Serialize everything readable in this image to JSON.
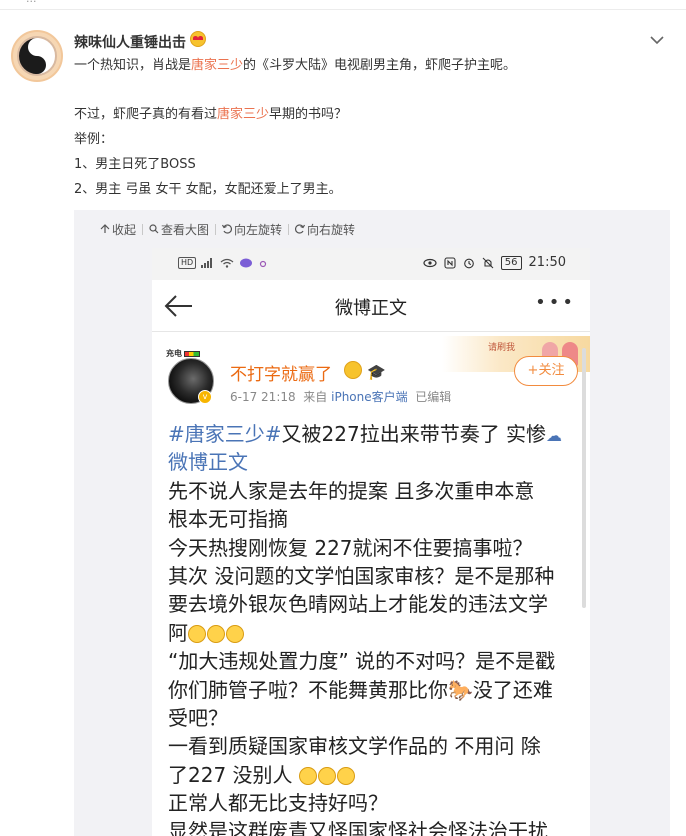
{
  "top_strip": {
    "label": " ..."
  },
  "post": {
    "author": "辣味仙人重锤出击",
    "line1_a": "一个热知识，肖战是",
    "line1_hl": "唐家三少",
    "line1_b": "的《斗罗大陆》电视剧男主角，虾爬子护主呢。",
    "line2_a": "不过，虾爬子真的有看过",
    "line2_hl": "唐家三少",
    "line2_b": "早期的书吗？",
    "line3": "举例：",
    "line4": "1、男主日死了BOSS",
    "line5": "2、男主 弓虽 女干 女配，女配还爱上了男主。"
  },
  "toolbar": {
    "collapse": "收起",
    "view_large": "查看大图",
    "rotate_left": "向左旋转",
    "rotate_right": "向右旋转"
  },
  "phone": {
    "status": {
      "hd": "HD",
      "battery": "56",
      "time": "21:50"
    },
    "nav_title": "微博正文",
    "banner_text": "请刷我",
    "charge_label": "充电",
    "author_name": "不打字就赢了",
    "meta_time": "6-17 21:18",
    "meta_from": "来自",
    "meta_source": "iPhone客户端",
    "meta_edited": "已编辑",
    "follow": "+关注",
    "lines": {
      "l1_link": "#唐家三少#",
      "l1_text": "又被227拉出来带节奏了 实惨",
      "l2_link": "微博正文",
      "l3": "先不说人家是去年的提案 且多次重申本意",
      "l4": "根本无可指摘",
      "l5": "今天热搜刚恢复 227就闲不住要搞事啦？",
      "l6": "其次 没问题的文学怕国家审核？是不是那种",
      "l7": "要去境外银灰色晴网站上才能发的违法文学",
      "l8": "阿",
      "l9": "“加大违规处置力度” 说的不对吗？是不是戳",
      "l10_a": "你们肺管子啦？不能舞黄那比你",
      "l10_b": "没了还难",
      "l11": "受吧？",
      "l12": "一看到质疑国家审核文学作品的 不用问 除",
      "l13": "了227  没别人 ",
      "l14": "正常人都无比支持好吗？",
      "l15": "显然是这群废青又怪国家怪社会怪法治干扰"
    }
  },
  "colors": {
    "highlight": "#eb7350",
    "link": "#4a74b6",
    "orange_name": "#eb6a12"
  },
  "icons": [
    "chevron-down-icon",
    "back-arrow-icon",
    "more-icon",
    "collapse-icon",
    "search-icon",
    "rotate-left-icon",
    "rotate-right-icon"
  ]
}
